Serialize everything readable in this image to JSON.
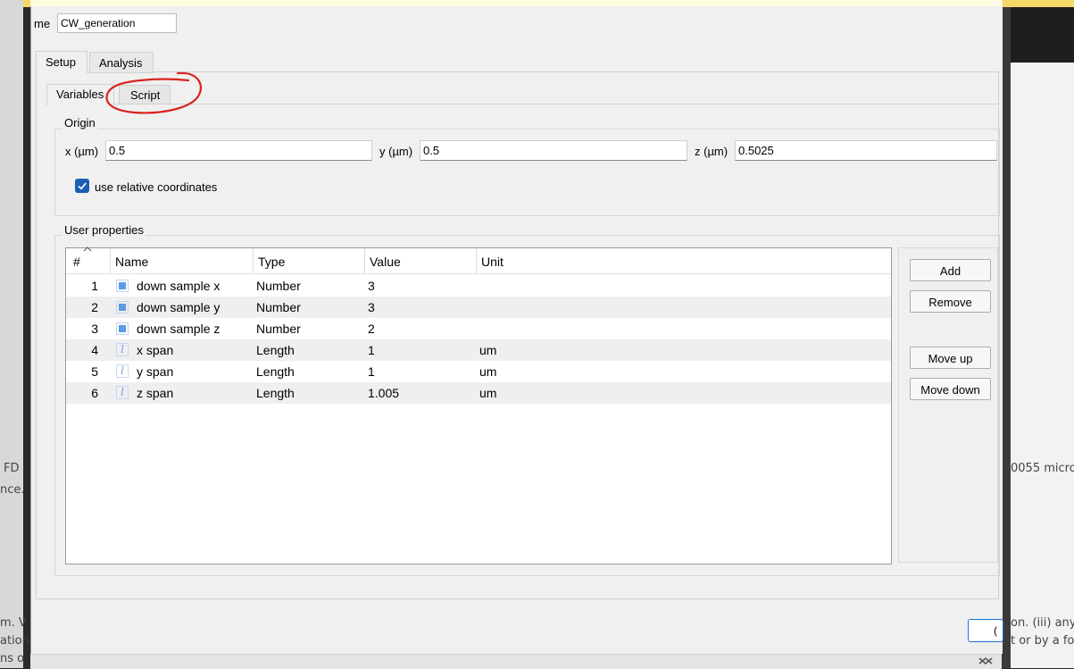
{
  "background": {
    "fragments": [
      "FD",
      "nce.",
      "m. V",
      "ation",
      "ns o",
      "0055 micro",
      "on. (iii) any",
      "t or by a fo"
    ]
  },
  "dialog": {
    "name_label": "me",
    "name_value": "CW_generation",
    "tabs": [
      {
        "label": "Setup"
      },
      {
        "label": "Analysis"
      }
    ],
    "subtabs": [
      {
        "label": "Variables"
      },
      {
        "label": "Script"
      }
    ],
    "origin": {
      "title": "Origin",
      "x_label": "x (µm)",
      "x_value": "0.5",
      "y_label": "y (µm)",
      "y_value": "0.5",
      "z_label": "z (µm)",
      "z_value": "0.5025",
      "relative_label": "use relative coordinates",
      "relative_checked": true
    },
    "user_properties": {
      "title": "User properties",
      "columns": [
        "#",
        "Name",
        "Type",
        "Value",
        "Unit"
      ],
      "rows": [
        {
          "num": "1",
          "icon": "number-icon",
          "name": "down sample x",
          "type": "Number",
          "value": "3",
          "unit": ""
        },
        {
          "num": "2",
          "icon": "number-icon",
          "name": "down sample y",
          "type": "Number",
          "value": "3",
          "unit": ""
        },
        {
          "num": "3",
          "icon": "number-icon",
          "name": "down sample z",
          "type": "Number",
          "value": "2",
          "unit": ""
        },
        {
          "num": "4",
          "icon": "length-icon",
          "name": "x span",
          "type": "Length",
          "value": "1",
          "unit": "um"
        },
        {
          "num": "5",
          "icon": "length-icon",
          "name": "y span",
          "type": "Length",
          "value": "1",
          "unit": "um"
        },
        {
          "num": "6",
          "icon": "length-icon",
          "name": "z span",
          "type": "Length",
          "value": "1.005",
          "unit": "um"
        }
      ]
    },
    "buttons": {
      "add": "Add",
      "remove": "Remove",
      "move_up": "Move up",
      "move_down": "Move down"
    },
    "ok_partial": "("
  },
  "colors": {
    "accent": "#1a5fb4",
    "annotation": "#d9231f",
    "number_icon": "#5d9be8"
  }
}
